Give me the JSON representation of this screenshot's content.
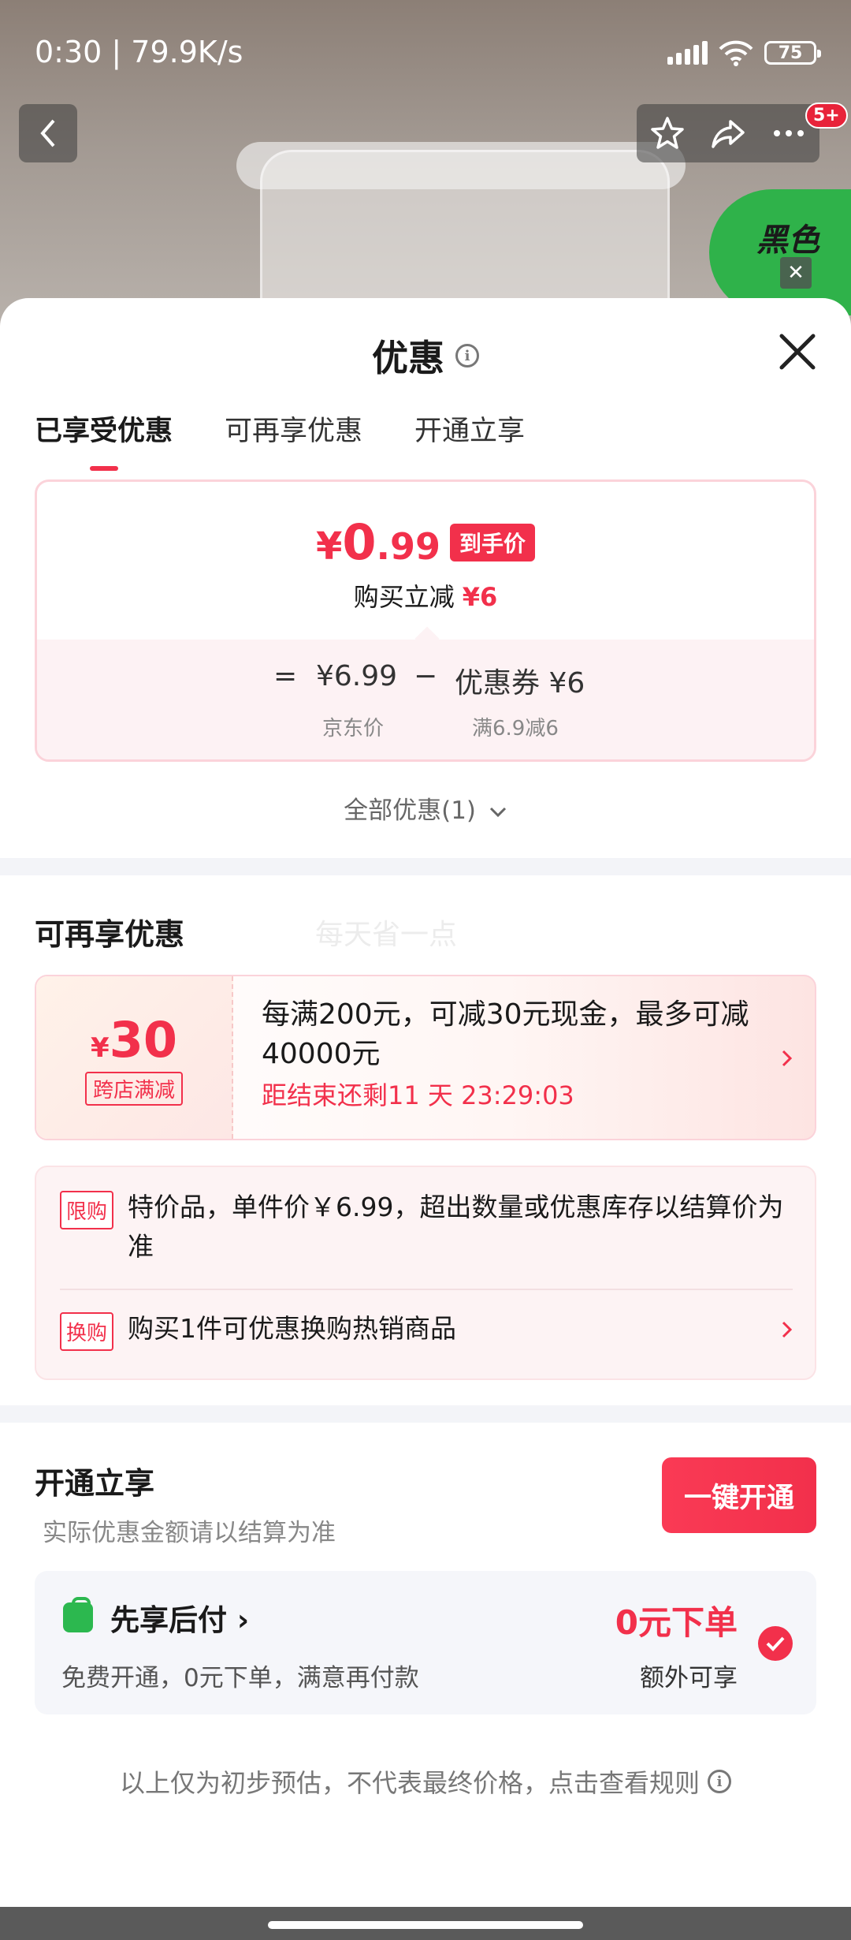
{
  "status_bar": {
    "time": "0:30 | 79.9K/s",
    "battery": "75"
  },
  "top_bar": {
    "badge": "5+"
  },
  "background": {
    "promo_text": "黑色"
  },
  "sheet": {
    "title": "优惠",
    "tabs": [
      {
        "label": "已享受优惠",
        "active": true
      },
      {
        "label": "可再享优惠",
        "active": false
      },
      {
        "label": "开通立享",
        "active": false
      }
    ],
    "price_card": {
      "currency": "¥",
      "price_int": "0",
      "price_dec": ".99",
      "tag": "到手价",
      "save_label": "购买立减",
      "save_amount": "¥6",
      "equals": "=",
      "base_price": "¥6.99",
      "minus": "−",
      "coupon_label": "优惠券 ¥6",
      "base_label": "京东价",
      "coupon_condition": "满6.9减6"
    },
    "all_discount": "全部优惠(1)",
    "more_section": {
      "title": "可再享优惠",
      "watermark": "每天省一点",
      "coupon": {
        "currency": "¥",
        "amount": "30",
        "tag": "跨店满减",
        "description": "每满200元，可减30元现金，最多可减40000元",
        "timer": "距结束还剩11 天 23:29:03"
      },
      "rules": [
        {
          "tag": "限购",
          "text": "特价品，单件价￥6.99，超出数量或优惠库存以结算价为准"
        },
        {
          "tag": "换购",
          "text": "购买1件可优惠换购热销商品"
        }
      ]
    },
    "open_section": {
      "title": "开通立享",
      "subtitle": "实际优惠金额请以结算为准",
      "button": "一键开通",
      "pay_later": {
        "title": "先享后付 ›",
        "description": "免费开通，0元下单，满意再付款",
        "value": "0元下单",
        "extra": "额外可享"
      }
    },
    "footer_note": "以上仅为初步预估，不代表最终价格，点击查看规则"
  },
  "colors": {
    "accent": "#f2304b",
    "green": "#2cb84f"
  }
}
